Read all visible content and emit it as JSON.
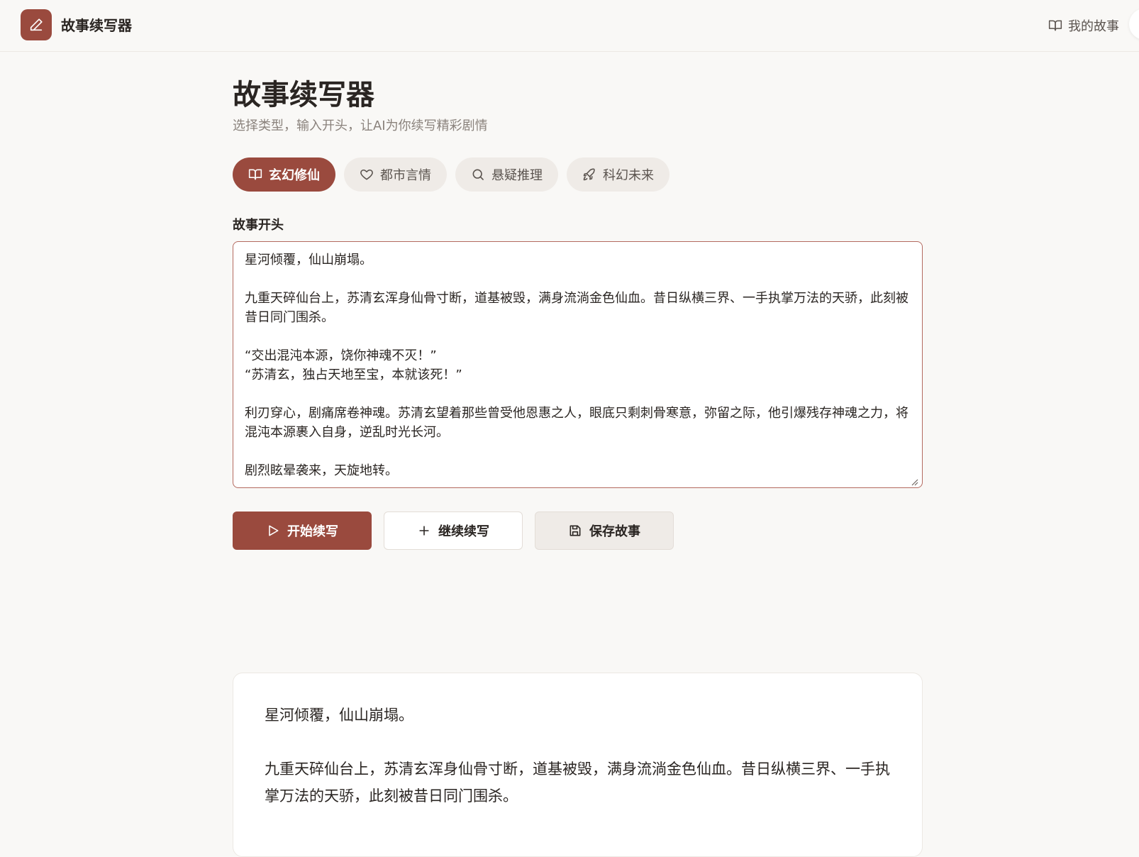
{
  "header": {
    "app_name": "故事续写器",
    "my_stories_label": "我的故事"
  },
  "page": {
    "title": "故事续写器",
    "subtitle": "选择类型，输入开头，让AI为你续写精彩剧情"
  },
  "genres": [
    {
      "label": "玄幻修仙",
      "icon": "book-open-icon",
      "active": true
    },
    {
      "label": "都市言情",
      "icon": "heart-icon",
      "active": false
    },
    {
      "label": "悬疑推理",
      "icon": "search-icon",
      "active": false
    },
    {
      "label": "科幻未来",
      "icon": "rocket-icon",
      "active": false
    }
  ],
  "editor": {
    "label": "故事开头",
    "value": "星河倾覆，仙山崩塌。\n\n九重天碎仙台上，苏清玄浑身仙骨寸断，道基被毁，满身流淌金色仙血。昔日纵横三界、一手执掌万法的天骄，此刻被昔日同门围杀。\n\n“交出混沌本源，饶你神魂不灭！”\n“苏清玄，独占天地至宝，本就该死！”\n\n利刃穿心，剧痛席卷神魂。苏清玄望着那些曾受他恩惠之人，眼底只剩刺骨寒意，弥留之际，他引爆残存神魂之力，将混沌本源裹入自身，逆乱时光长河。\n\n剧烈眩晕袭来，天旋地转。"
  },
  "actions": {
    "start_label": "开始续写",
    "continue_label": "继续续写",
    "save_label": "保存故事"
  },
  "story": {
    "paragraphs": [
      "星河倾覆，仙山崩塌。",
      "九重天碎仙台上，苏清玄浑身仙骨寸断，道基被毁，满身流淌金色仙血。昔日纵横三界、一手执掌万法的天骄，此刻被昔日同门围杀。"
    ]
  },
  "colors": {
    "accent": "#9a4a3e",
    "background": "#f9f8f6",
    "chip_bg": "#efebe7",
    "text": "#2a2522",
    "muted_text": "#8a827c"
  }
}
